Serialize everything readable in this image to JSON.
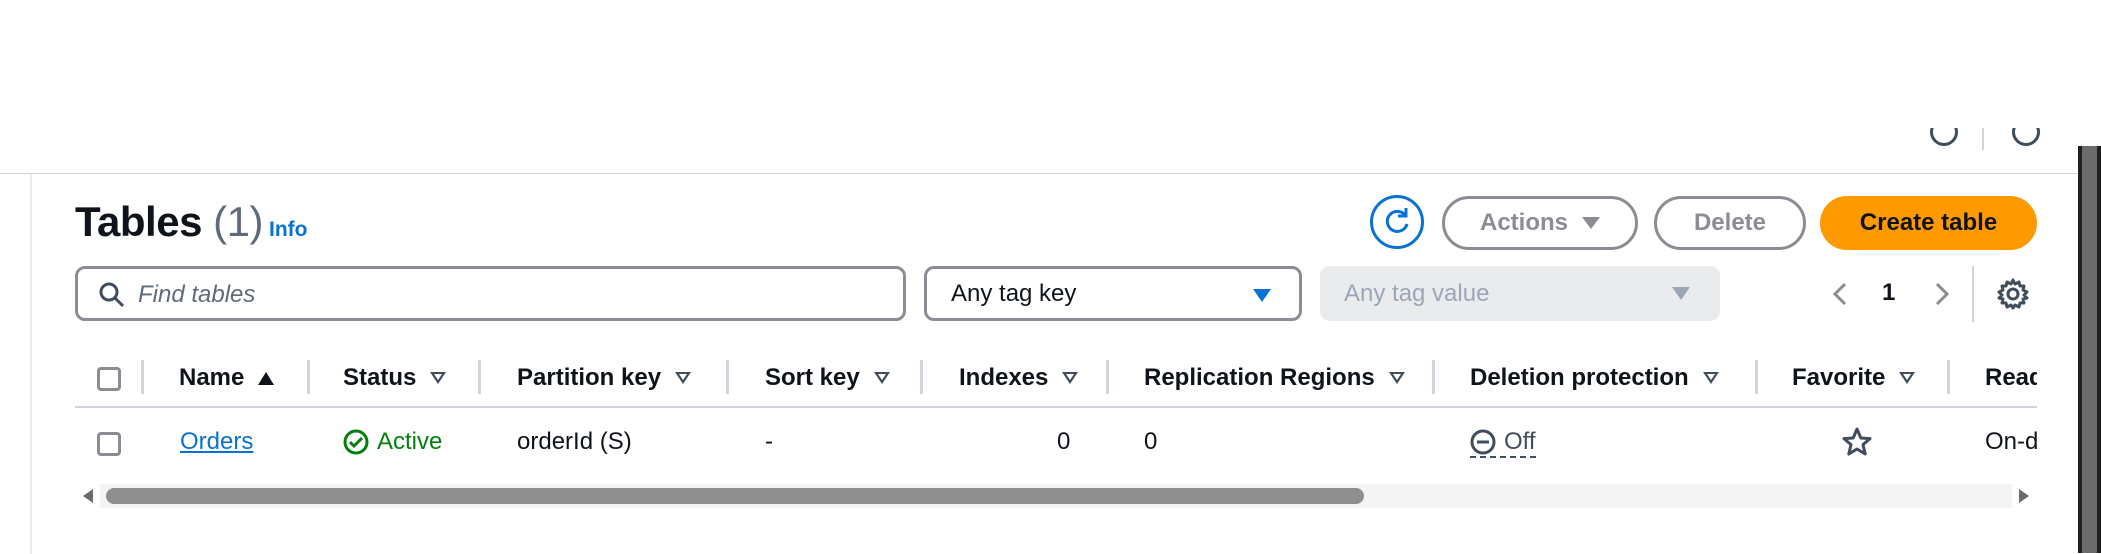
{
  "header": {
    "title": "Tables",
    "count": "(1)",
    "info_label": "Info"
  },
  "toolbar": {
    "refresh_icon": "refresh-icon",
    "actions_label": "Actions",
    "delete_label": "Delete",
    "create_label": "Create table"
  },
  "filters": {
    "search_placeholder": "Find tables",
    "tag_key_value": "Any tag key",
    "tag_value_placeholder": "Any tag value"
  },
  "pagination": {
    "current_page": "1"
  },
  "table": {
    "columns": [
      "Name",
      "Status",
      "Partition key",
      "Sort key",
      "Indexes",
      "Replication Regions",
      "Deletion protection",
      "Favorite",
      "Read"
    ],
    "rows": [
      {
        "name": "Orders",
        "status": "Active",
        "partition_key": "orderId (S)",
        "sort_key": "-",
        "indexes": "0",
        "replication_regions": "0",
        "deletion_protection": "Off",
        "favorite": "star-outline-icon",
        "read_capacity": "On-d"
      }
    ]
  },
  "colors": {
    "accent": "#0972d3",
    "primary_button": "#ff9900",
    "success": "#037f0c",
    "muted": "#8c8c94"
  }
}
